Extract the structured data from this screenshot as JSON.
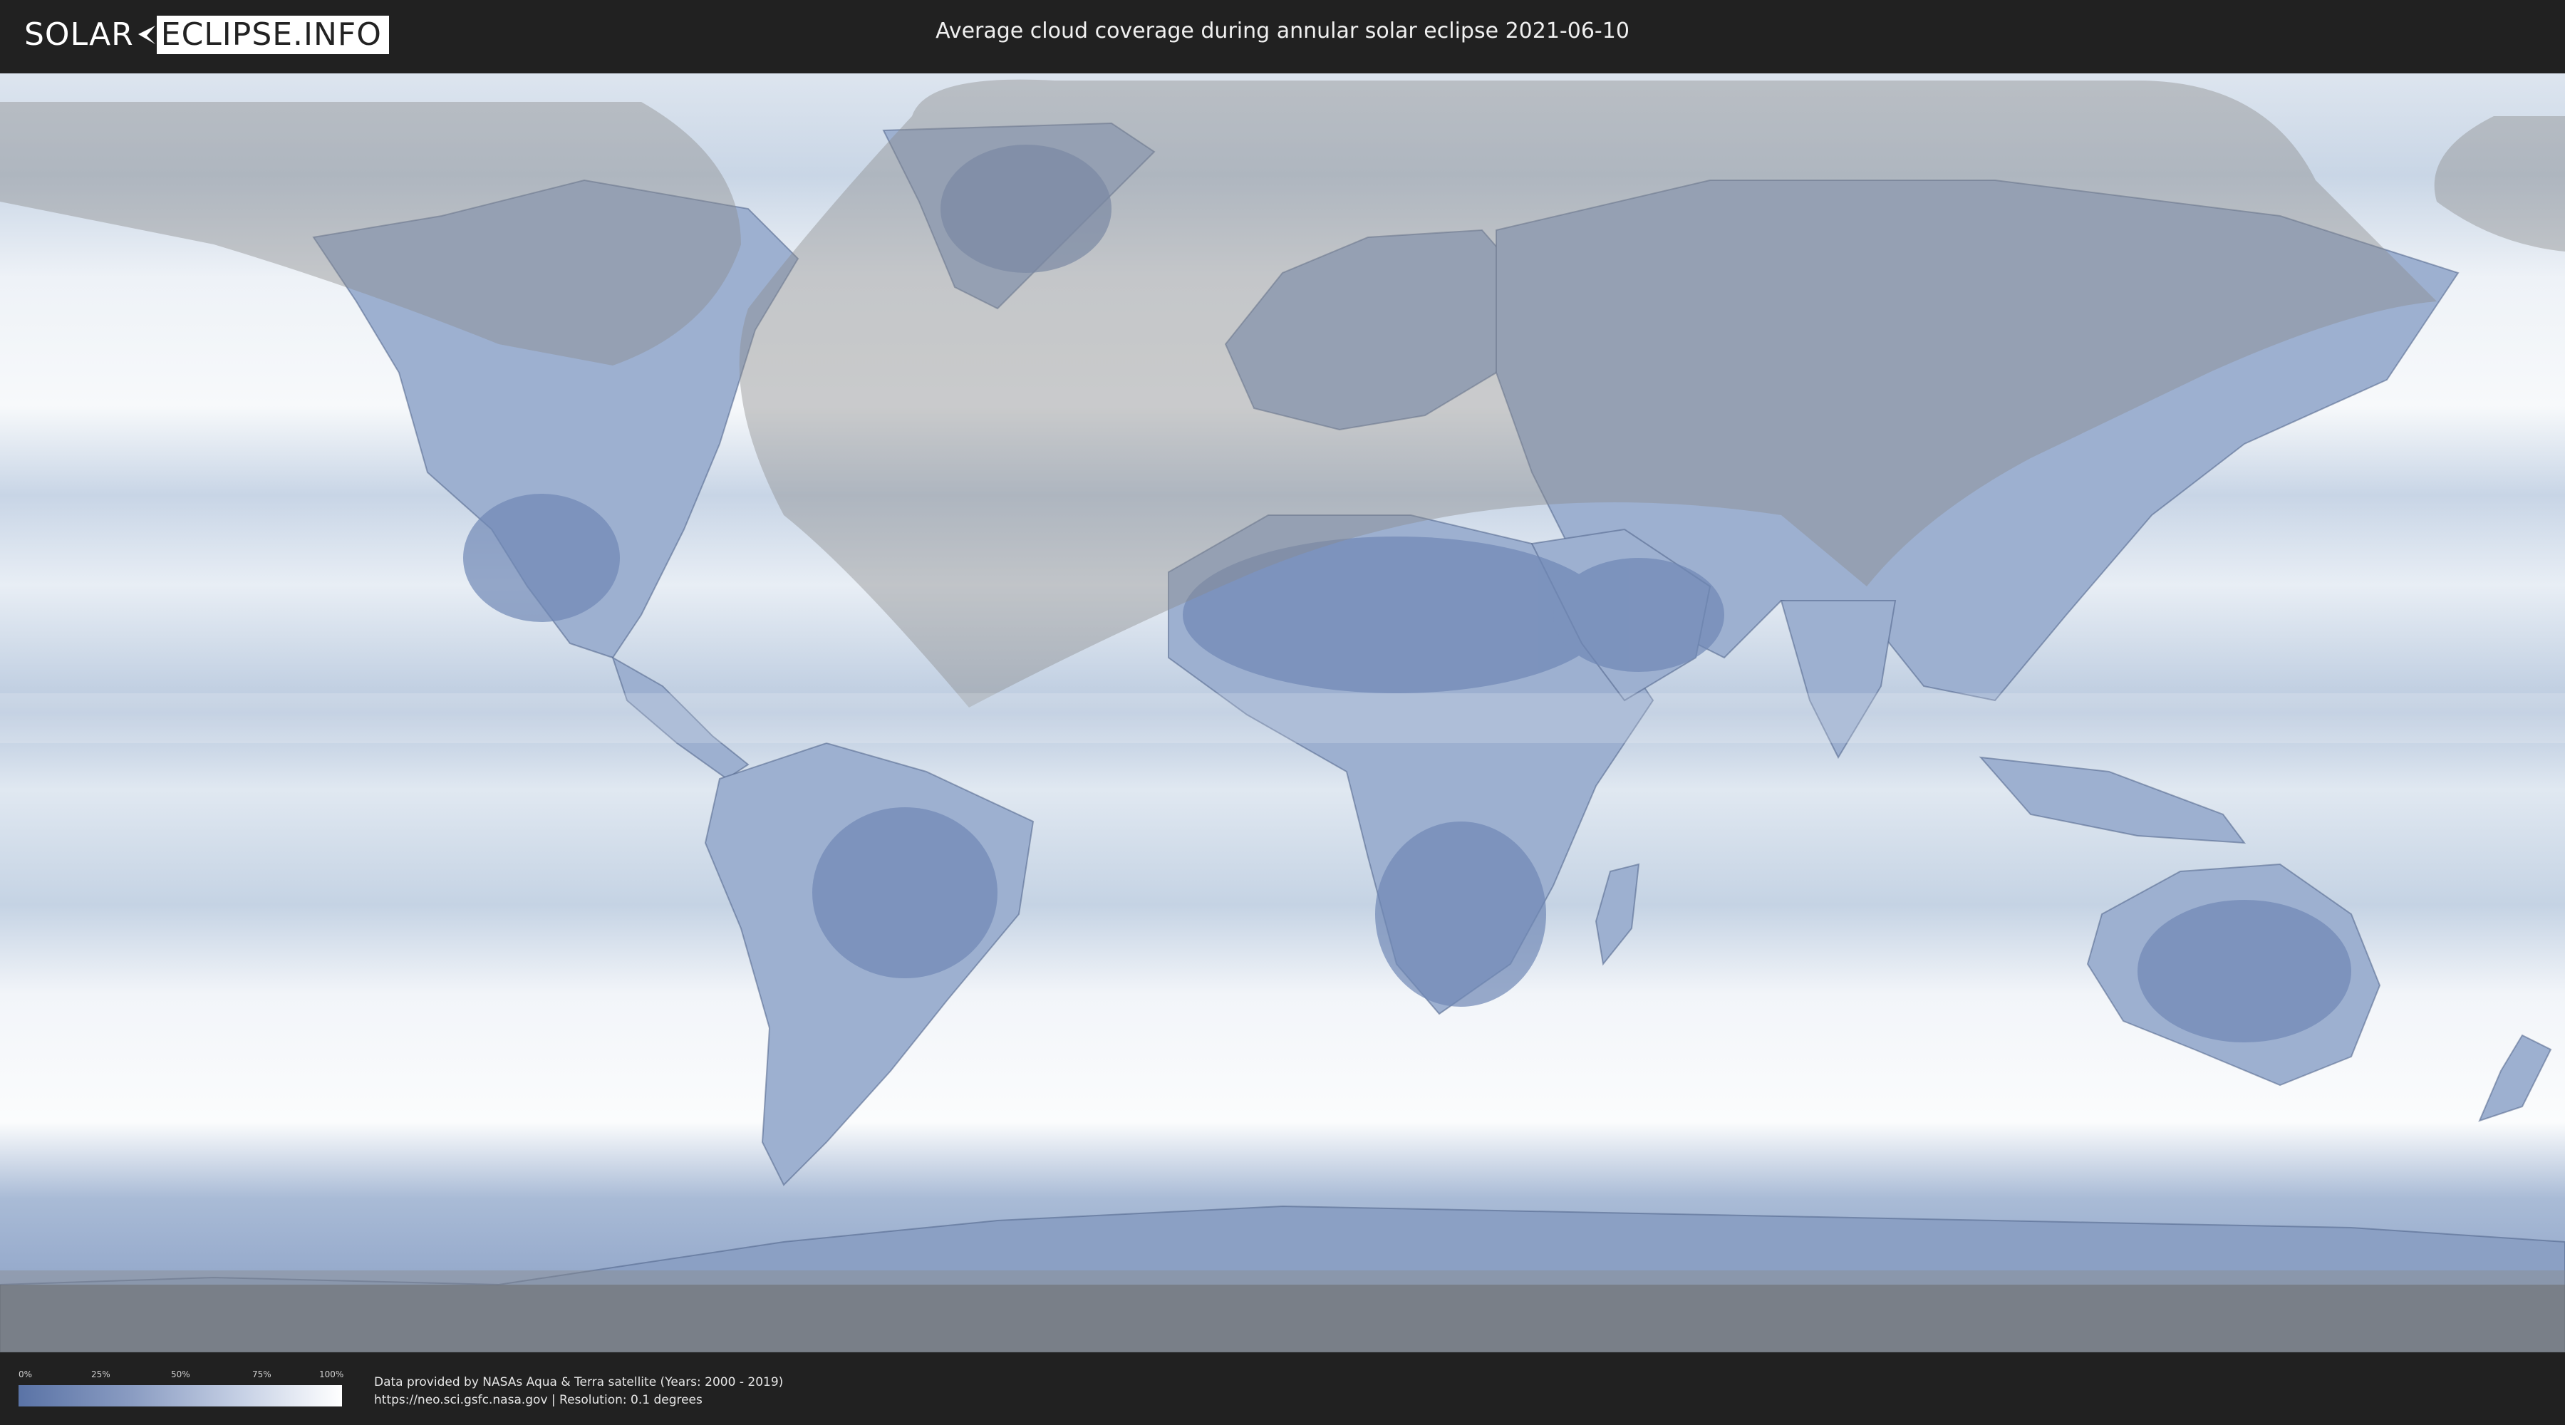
{
  "header": {
    "logo_left": "SOLAR",
    "logo_right": "ECLIPSE.INFO",
    "title": "Average cloud coverage during annular solar eclipse 2021-06-10"
  },
  "map": {
    "projection": "equirectangular",
    "colors": {
      "clear_sky": "#5a73a6",
      "full_cloud": "#ffffff",
      "eclipse_shadow_overlay": "#8a8a8a",
      "border_lines": "#3a4a6a"
    }
  },
  "legend": {
    "ticks": [
      "0%",
      "25%",
      "50%",
      "75%",
      "100%"
    ],
    "gradient_colors": [
      "#5a73a6",
      "#8a9cc2",
      "#c8d2e6",
      "#ffffff"
    ]
  },
  "footer": {
    "credit_line1": "Data provided by NASAs Aqua & Terra satellite (Years: 2000 - 2019)",
    "credit_line2": "https://neo.sci.gsfc.nasa.gov | Resolution: 0.1 degrees"
  }
}
